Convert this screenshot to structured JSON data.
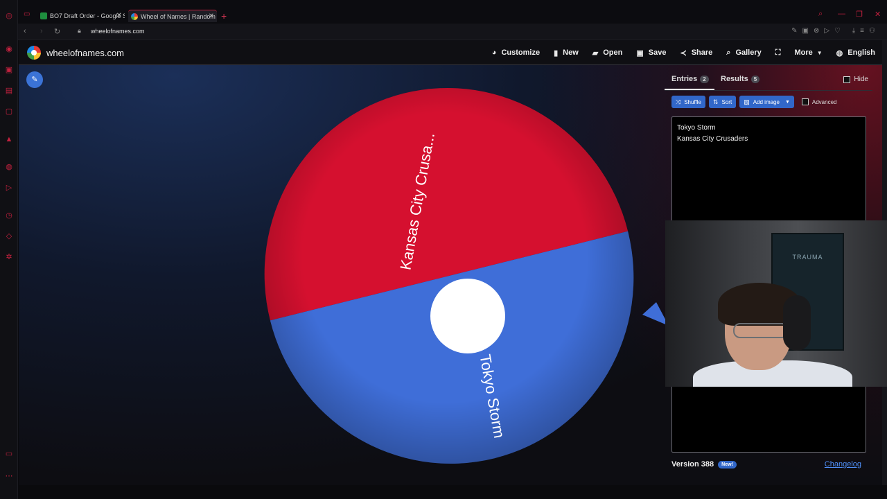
{
  "browser": {
    "tabs": [
      {
        "title": "BO7 Draft Order - Google S",
        "favicon_color": "#1e8e3e"
      },
      {
        "title": "Wheel of Names | Random",
        "favicon_color": "#e53935"
      }
    ],
    "new_tab_symbol": "+",
    "close_symbol": "✕",
    "url": "wheelofnames.com"
  },
  "site": {
    "brand": "wheelofnames.com",
    "menu": [
      {
        "label": "Customize",
        "icon": "palette-icon"
      },
      {
        "label": "New",
        "icon": "file-icon"
      },
      {
        "label": "Open",
        "icon": "folder-icon"
      },
      {
        "label": "Save",
        "icon": "save-icon"
      },
      {
        "label": "Share",
        "icon": "share-icon"
      },
      {
        "label": "Gallery",
        "icon": "search-icon"
      },
      {
        "label": "",
        "icon": "fullscreen-icon"
      },
      {
        "label": "More",
        "icon": "chevron-down-icon"
      },
      {
        "label": "English",
        "icon": "globe-icon"
      }
    ]
  },
  "wheel": {
    "segments": [
      {
        "label": "Kansas City Crusa...",
        "color": "#d5102f"
      },
      {
        "label": "Tokyo Storm",
        "color": "#3f6ed8"
      }
    ],
    "pointer_color": "#3f6ed8"
  },
  "panel": {
    "tabs": [
      {
        "label": "Entries",
        "count": "2"
      },
      {
        "label": "Results",
        "count": "5"
      }
    ],
    "hide_label": "Hide",
    "buttons": {
      "shuffle": "Shuffle",
      "sort": "Sort",
      "add_image": "Add image",
      "advanced": "Advanced"
    },
    "entries": [
      "Tokyo Storm",
      "Kansas City Crusaders"
    ],
    "version": "Version 388",
    "new_badge": "New!",
    "changelog": "Changelog"
  },
  "webcam": {
    "poster_text": "TRAUMA"
  }
}
